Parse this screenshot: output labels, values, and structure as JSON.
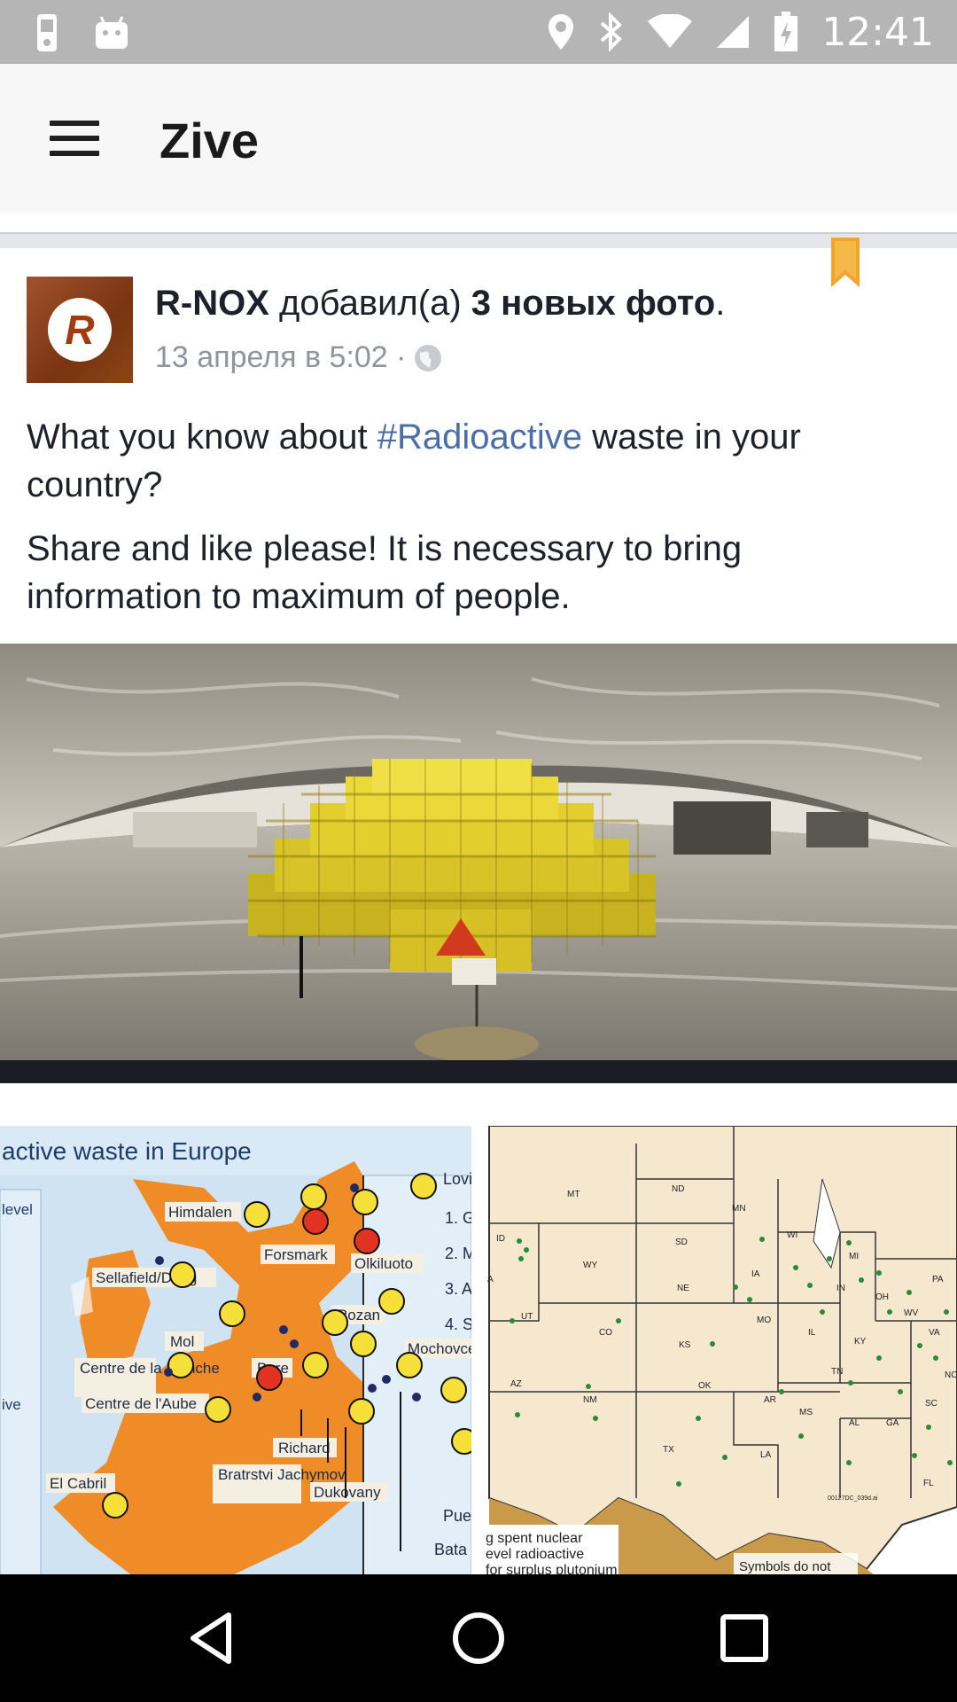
{
  "status_bar": {
    "time": "12:41",
    "icons": [
      "phone-storage-icon",
      "android-icon",
      "location-icon",
      "bluetooth-icon",
      "wifi-icon",
      "signal-icon",
      "battery-icon"
    ]
  },
  "app_bar": {
    "title": "Zive",
    "menu_icon": "hamburger-menu-icon"
  },
  "post": {
    "author": "R-NOX",
    "action": " добавил(а) ",
    "object": "3 новых фото",
    "object_suffix": ".",
    "timestamp": "13 апреля в 5:02 ·",
    "privacy_icon": "globe-icon",
    "avatar_letter": "R",
    "text_line1_prefix": "What you know about ",
    "hashtag": "#Radioactive",
    "text_line1_suffix": " waste in your country?",
    "text_paragraph2": "Share and like please! It is necessary to bring information to maximum of people.",
    "bookmark_icon": "bookmark-icon"
  },
  "photos": {
    "left_map": {
      "title": "active waste in Europe",
      "labels": [
        "Himdalen",
        "Forsmark",
        "Olkiluoto",
        "Sellafield/Drigg",
        "Rozan",
        "Mol",
        "Centre de la Manche",
        "Bure",
        "Centre de l'Aube",
        "Mochovce",
        "Richard",
        "Bratrstvi Jachymov",
        "Dukovany",
        "El Cabril",
        "Lovi",
        "Pue",
        "Bata",
        "level",
        "ive"
      ],
      "legend": [
        "1. G",
        "2. M",
        "3. A",
        "4. S"
      ]
    },
    "right_map": {
      "states": [
        "MT",
        "ND",
        "MN",
        "WI",
        "MI",
        "ID",
        "SD",
        "WY",
        "IA",
        "NE",
        "IN",
        "OH",
        "PA",
        "UT",
        "CO",
        "IL",
        "WV",
        "KS",
        "MO",
        "KY",
        "VA",
        "NC",
        "AZ",
        "NM",
        "OK",
        "TN",
        "AR",
        "SC",
        "MS",
        "AL",
        "GA",
        "TX",
        "LA",
        "FL",
        "A"
      ],
      "captions": [
        "g spent nuclear",
        "evel radioactive",
        "for surplus plutonium",
        "Symbols do not",
        "00127DC_039d.ai"
      ]
    }
  },
  "nav_bar": {
    "icons": [
      "back-icon",
      "home-icon",
      "recents-icon"
    ]
  },
  "colors": {
    "status_bar": "#b5b5b5",
    "app_bar": "#f7f7f7",
    "hashtag": "#4b6ea9",
    "bookmark": "#f0a530",
    "europe_orange": "#f08c28",
    "usa_tan": "#f6e8cf"
  }
}
